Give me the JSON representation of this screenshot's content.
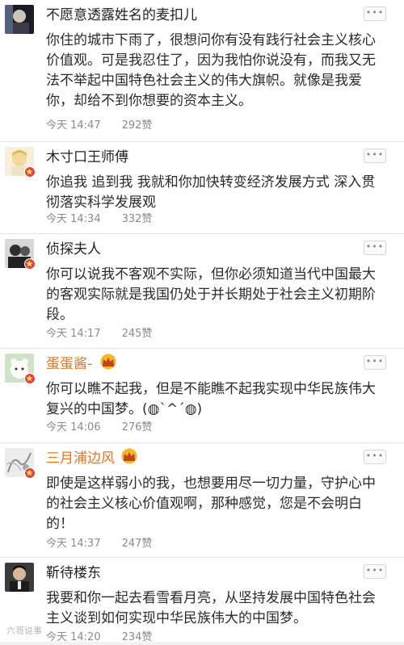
{
  "comments": [
    {
      "username": "不愿意透露姓名的麦扣儿",
      "text": "你住的城市下雨了，很想问你有没有践行社会主义核心价值观。可是我忍住了，因为我怕你说没有，而我又无法不举起中国特色社会主义的伟大旗帜。就像是我爱你，却给不到你想要的资本主义。",
      "time": "今天 14:47",
      "likes": "292赞",
      "vip": false,
      "verified": false
    },
    {
      "username": "木寸口王师傅",
      "text": "你追我 追到我 我就和你加快转变经济发展方式 深入贯彻落实科学发展观",
      "time": "今天 14:34",
      "likes": "332赞",
      "vip": false,
      "verified": true
    },
    {
      "username": "侦探夫人",
      "text": "你可以说我不客观不实际，但你必须知道当代中国最大的客观实际就是我国仍处于并长期处于社会主义初期阶段。",
      "time": "今天 14:17",
      "likes": "245赞",
      "vip": false,
      "verified": true
    },
    {
      "username": "蛋蛋酱-",
      "text": "你可以瞧不起我，但是不能瞧不起我实现中华民族伟大复兴的中国梦。(◍`^´◍)",
      "time": "今天 14:06",
      "likes": "276赞",
      "vip": true,
      "verified": true
    },
    {
      "username": "三月浦边风",
      "text": "即使是这样弱小的我，也想要用尽一切力量，守护心中的社会主义核心价值观啊，那种感觉，您是不会明白的！",
      "time": "今天 14:37",
      "likes": "247赞",
      "vip": true,
      "verified": true
    },
    {
      "username": "靳待楼东",
      "text": "我要和你一起去看雪看月亮，从坚持发展中国特色社会主义谈到如何实现中华民族伟大的中国梦。",
      "time": "今天 14:20",
      "likes": "234赞",
      "vip": false,
      "verified": false
    }
  ],
  "more_label": "•••",
  "watermark": "六哥说事"
}
